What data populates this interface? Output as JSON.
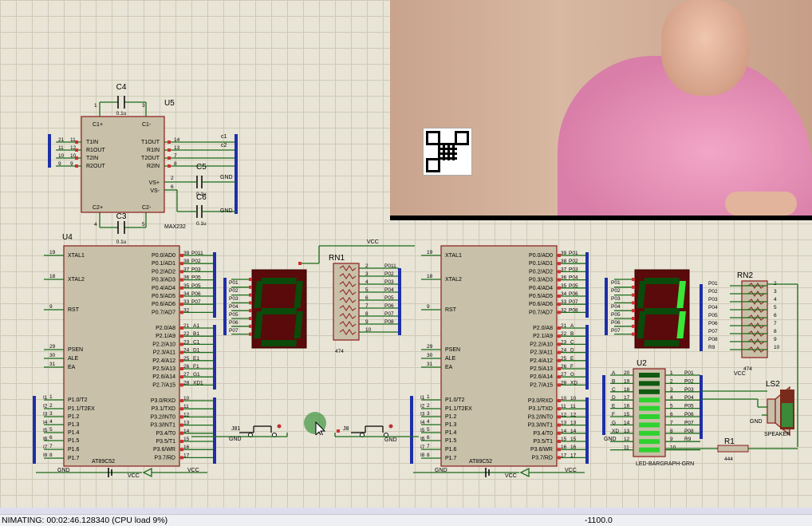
{
  "status": {
    "animating": "NIMATING: 00:02:46.128340 (CPU load 9%)",
    "coord": "-1100.0"
  },
  "schematic": {
    "u5": {
      "ref": "U5",
      "part": "MAX232",
      "pins_left": [
        "T1IN",
        "R1OUT",
        "T2IN",
        "R2OUT"
      ],
      "pins_right": [
        "T1OUT",
        "R1IN",
        "T2OUT",
        "R2IN"
      ],
      "top": [
        "C1+",
        "C1-"
      ],
      "bottom": [
        "C2+",
        "C2-"
      ],
      "right2": [
        "VS+",
        "VS-"
      ],
      "num_left": [
        "11",
        "12",
        "10",
        "9"
      ],
      "num_right": [
        "14",
        "13",
        "7",
        "8"
      ],
      "ext_left": [
        "21",
        "11",
        "10",
        "9"
      ],
      "ext_right": [
        "c1",
        "c2"
      ],
      "num_top": [
        "1",
        "3"
      ],
      "num_bot": [
        "4",
        "5"
      ],
      "num_vs": [
        "2",
        "6"
      ]
    },
    "caps": {
      "c4": "C4",
      "c5": "C5",
      "c6": "C6",
      "c3": "C3",
      "val": "0.1u"
    },
    "u4": {
      "ref": "U4",
      "part": "AT89C52"
    },
    "u2mcu": {
      "part": "AT89C52"
    },
    "rn1": {
      "ref": "RN1",
      "val": "474",
      "vcc": "VCC"
    },
    "rn2": {
      "ref": "RN2",
      "val": "474",
      "vcc": "VCC"
    },
    "u2": {
      "ref": "U2",
      "part": "LED-BARGRAPH-GRN"
    },
    "ls2": {
      "ref": "LS2",
      "part": "SPEAKER"
    },
    "r1": {
      "ref": "R1",
      "val": "444"
    },
    "j81": "J81",
    "j8": "J8",
    "gnd": "GND",
    "vcc": "VCC",
    "mcu_left": [
      "XTAL1",
      "XTAL2",
      "RST",
      "PSEN",
      "ALE",
      "EA",
      "P1.0/T2",
      "P1.1/T2EX",
      "P1.2",
      "P1.3",
      "P1.4",
      "P1.5",
      "P1.6",
      "P1.7"
    ],
    "mcu_left_num": [
      "19",
      "18",
      "9",
      "29",
      "30",
      "31",
      "1",
      "2",
      "3",
      "4",
      "5",
      "6",
      "7",
      "8"
    ],
    "mcu_p0": [
      "P0.0/AD0",
      "P0.1/AD1",
      "P0.2/AD2",
      "P0.3/AD3",
      "P0.4/AD4",
      "P0.5/AD5",
      "P0.6/AD6",
      "P0.7/AD7"
    ],
    "mcu_p0_num": [
      "39",
      "38",
      "37",
      "36",
      "35",
      "34",
      "33",
      "32"
    ],
    "mcu_p2": [
      "P2.0/A8",
      "P2.1/A9",
      "P2.2/A10",
      "P2.3/A11",
      "P2.4/A12",
      "P2.5/A13",
      "P2.6/A14",
      "P2.7/A15"
    ],
    "mcu_p2_num": [
      "21",
      "22",
      "23",
      "24",
      "25",
      "26",
      "27",
      "28"
    ],
    "mcu_p3": [
      "P3.0/RXD",
      "P3.1/TXD",
      "P3.2/INT0",
      "P3.3/INT1",
      "P3.4/T0",
      "P3.5/T1",
      "P3.6/WR",
      "P3.7/RD"
    ],
    "mcu_p3_num": [
      "10",
      "11",
      "12",
      "13",
      "14",
      "15",
      "16",
      "17"
    ],
    "u4_p0_net": [
      "P011",
      "P02",
      "P03",
      "P05",
      "P05",
      "P06",
      "P07"
    ],
    "u4_p2_net": [
      "A1",
      "B1",
      "C1",
      "D1",
      "E1",
      "F1",
      "G1",
      "XD1"
    ],
    "u4_p1_net": [
      "I1",
      "I2",
      "I3",
      "I4",
      "I5",
      "I6",
      "I7",
      "I8"
    ],
    "u4_p3_net": [
      "11",
      "12",
      "13",
      "14",
      "15",
      "16",
      "17"
    ],
    "p0_nets": [
      "P01",
      "P02",
      "P03",
      "P04",
      "P05",
      "P06",
      "P07"
    ],
    "rn1_nets": [
      "P011",
      "P02",
      "P03",
      "P04",
      "P05",
      "P06",
      "P07",
      "P08"
    ],
    "rn1_pins": [
      "2",
      "3",
      "4",
      "5",
      "6",
      "7",
      "8",
      "9",
      "10"
    ],
    "mcu2_p0_net": [
      "P01",
      "P02",
      "P03",
      "P04",
      "P05",
      "P06",
      "P07"
    ],
    "mcu2_p2_net": [
      "A",
      "B",
      "C",
      "D",
      "E",
      "F",
      "G",
      "XD"
    ],
    "mcu2_p3_net": [
      "10",
      "11",
      "12",
      "13",
      "14",
      "15",
      "16",
      "17"
    ],
    "rn2_nets": [
      "P01",
      "P02",
      "P03",
      "P04",
      "P05",
      "P06",
      "P07",
      "P08",
      "R9"
    ],
    "rn2_pins": [
      "2",
      "3",
      "4",
      "5",
      "6",
      "7",
      "8",
      "9",
      "10"
    ],
    "bar_left": [
      "A",
      "B",
      "C",
      "D",
      "E",
      "F",
      "G",
      "XD"
    ],
    "bar_left_num": [
      "20",
      "19",
      "18",
      "17",
      "16",
      "15",
      "14",
      "13",
      "12",
      "11"
    ],
    "bar_right": [
      "P01",
      "P02",
      "P03",
      "P04",
      "P05",
      "P06",
      "P07",
      "P08",
      "R9"
    ],
    "bar_right_num": [
      "1",
      "2",
      "3",
      "4",
      "5",
      "6",
      "7",
      "8",
      "9",
      "10"
    ]
  }
}
